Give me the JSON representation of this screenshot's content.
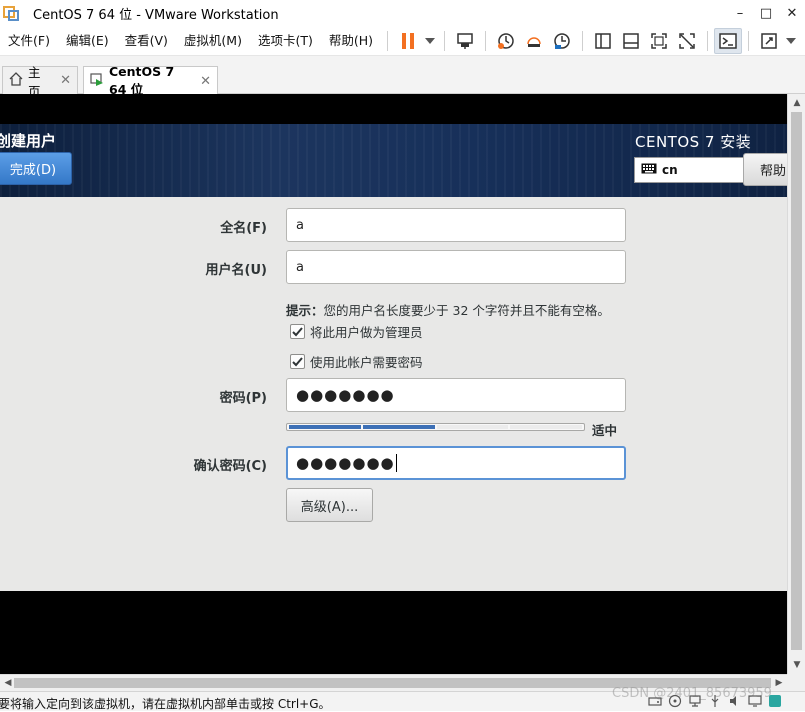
{
  "window": {
    "title": "CentOS 7 64 位 - VMware Workstation",
    "controls": {
      "minimize": "–",
      "restore": "□",
      "close": "✕"
    }
  },
  "menu": {
    "items": [
      "文件(F)",
      "编辑(E)",
      "查看(V)",
      "虚拟机(M)",
      "选项卡(T)",
      "帮助(H)"
    ]
  },
  "toolbar": {
    "icons": [
      "pause-icon",
      "dropdown-icon",
      "send-ctrl-alt-del-icon",
      "snapshot-icon",
      "revert-snapshot-icon",
      "snapshot-manager-icon",
      "sidebar-icon",
      "console-view-icon",
      "fullscreen-icon",
      "unity-icon",
      "terminal-icon",
      "stretch-icon"
    ],
    "accent": "#f37021"
  },
  "tabs": [
    {
      "label": "主页",
      "active": false,
      "close": "✕"
    },
    {
      "label": "CentOS 7 64 位",
      "active": true,
      "close": "✕"
    }
  ],
  "installer": {
    "spoke_title": "创建用户",
    "done_button": "完成(D)",
    "product_title": "CENTOS 7 安装",
    "keyboard_layout": "cn",
    "help_button": "帮助",
    "form": {
      "fullname_label": "全名(F)",
      "fullname_value": "a",
      "username_label": "用户名(U)",
      "username_value": "a",
      "hint_prefix": "提示：",
      "hint_text": "您的用户名长度要少于 32 个字符并且不能有空格。",
      "admin_checkbox_label": "将此用户做为管理员",
      "admin_checked": true,
      "require_password_label": "使用此帐户需要密码",
      "require_password_checked": true,
      "password_label": "密码(P)",
      "password_value": "●●●●●●●",
      "strength_level": 0.5,
      "strength_label": "适中",
      "confirm_label": "确认密码(C)",
      "confirm_value": "●●●●●●●",
      "advanced_button": "高级(A)..."
    }
  },
  "scrollbars": {
    "up": "▲",
    "down": "▼",
    "left": "◀",
    "right": "▶"
  },
  "statusbar": {
    "text": "要将输入定向到该虚拟机，请在虚拟机内部单击或按 Ctrl+G。",
    "watermark": "CSDN @2401_85673959"
  }
}
